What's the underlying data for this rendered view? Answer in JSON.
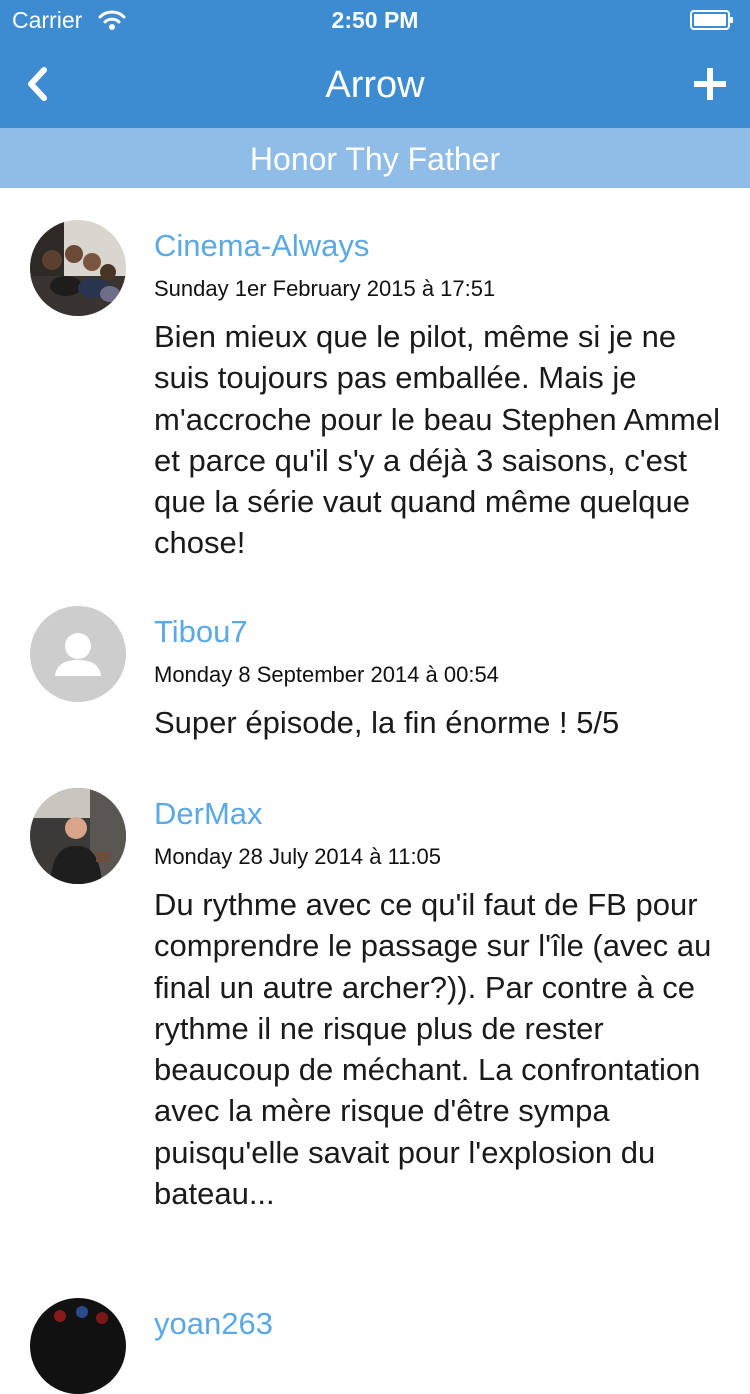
{
  "status_bar": {
    "carrier": "Carrier",
    "time": "2:50 PM"
  },
  "nav": {
    "title": "Arrow",
    "back_icon": "chevron-left-icon",
    "add_icon": "plus-icon"
  },
  "subheader": "Honor Thy Father",
  "colors": {
    "nav_bg": "#3d8bd1",
    "subheader_bg": "#8fbde8",
    "author": "#5aa9e6"
  },
  "comments": [
    {
      "author": "Cinema-Always",
      "date": "Sunday 1er February 2015 à 17:51",
      "text": "Bien mieux que le pilot, même si je ne suis toujours pas emballée. Mais je m'accroche pour le beau Stephen Ammel et parce qu'il s'y a déjà 3 saisons, c'est que la série vaut quand même quelque chose!",
      "avatar": "photo"
    },
    {
      "author": "Tibou7",
      "date": "Monday 8 September 2014 à 00:54",
      "text": "Super épisode, la fin énorme ! 5/5",
      "avatar": "default-user-icon"
    },
    {
      "author": "DerMax",
      "date": "Monday 28 July 2014 à 11:05",
      "text": "Du rythme avec ce qu'il faut de FB pour comprendre le passage sur l'île (avec au final un autre archer?)). Par contre à ce rythme il ne risque plus de rester beaucoup de méchant. La confrontation avec la mère risque d'être sympa puisqu'elle savait pour l'explosion du bateau...",
      "avatar": "photo"
    },
    {
      "author": "yoan263",
      "avatar": "photo"
    }
  ]
}
